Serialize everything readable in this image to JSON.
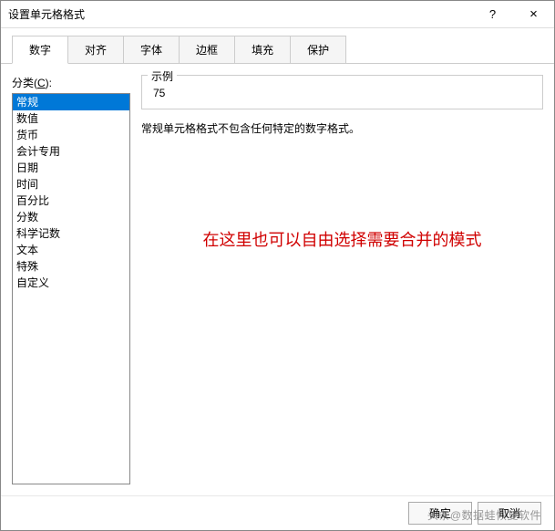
{
  "window": {
    "title": "设置单元格格式",
    "help": "?",
    "close": "×"
  },
  "tabs": [
    {
      "label": "数字",
      "active": true
    },
    {
      "label": "对齐",
      "active": false
    },
    {
      "label": "字体",
      "active": false
    },
    {
      "label": "边框",
      "active": false
    },
    {
      "label": "填充",
      "active": false
    },
    {
      "label": "保护",
      "active": false
    }
  ],
  "category": {
    "label_prefix": "分类(",
    "label_key": "C",
    "label_suffix": "):",
    "items": [
      "常规",
      "数值",
      "货币",
      "会计专用",
      "日期",
      "时间",
      "百分比",
      "分数",
      "科学记数",
      "文本",
      "特殊",
      "自定义"
    ],
    "selected_index": 0
  },
  "example": {
    "label": "示例",
    "value": "75"
  },
  "description": "常规单元格格式不包含任何特定的数字格式。",
  "annotation": "在这里也可以自由选择需要合并的模式",
  "buttons": {
    "ok": "确定",
    "cancel": "取消"
  },
  "watermark": "头条@数据蛙恢复软件"
}
